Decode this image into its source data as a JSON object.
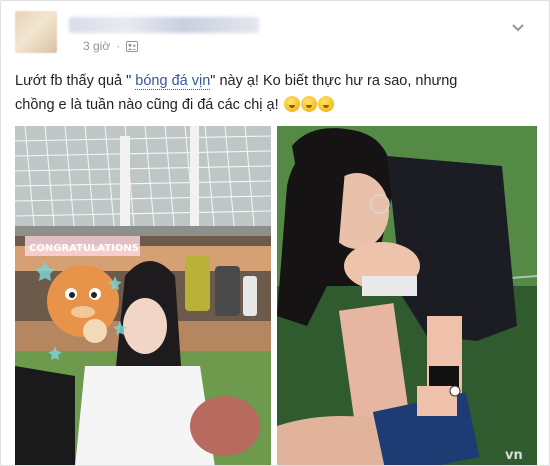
{
  "post": {
    "timestamp": "3 giờ",
    "privacy_icon": "friends-icon",
    "text_before_tag": "Lướt fb thấy quả \" ",
    "tag_text": "bóng đá vịn",
    "text_after_tag": "\" này ạ! Ko biết thực hư ra sao, nhưng",
    "line2_text": "chồng e là tuần nào cũng đi đá các chị ạ!",
    "emoji_name": "thinking-face-emoji",
    "emoji_count": 3
  },
  "photos": {
    "left_banner": "CONGRATULATIONS",
    "right_watermark": "vn"
  },
  "colors": {
    "link": "#365899",
    "text": "#1d2129",
    "meta": "#90949c"
  }
}
